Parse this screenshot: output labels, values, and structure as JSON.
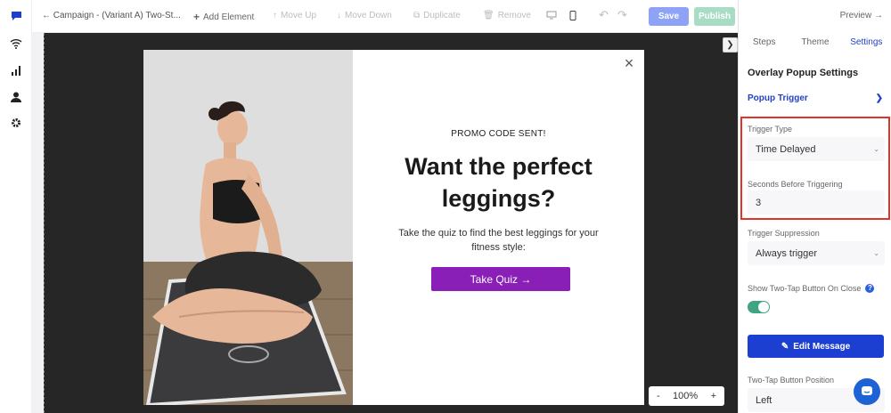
{
  "toolbar": {
    "back_label": "← Campaign - (Variant A) Two-St...",
    "add_element": "Add Element",
    "move_up": "Move Up",
    "move_down": "Move Down",
    "duplicate": "Duplicate",
    "remove": "Remove",
    "save": "Save",
    "publish": "Publish",
    "preview": "Preview →"
  },
  "popup": {
    "promo": "PROMO CODE SENT!",
    "headline_line1": "Want the perfect",
    "headline_line2": "leggings?",
    "sub_line1": "Take the quiz to find the best leggings for your",
    "sub_line2": "fitness style:",
    "cta": "Take Quiz →"
  },
  "zoom": {
    "minus": "-",
    "value": "100%",
    "plus": "+"
  },
  "panel": {
    "tabs": [
      "Steps",
      "Theme",
      "Settings"
    ],
    "active_tab": "Settings",
    "title": "Overlay Popup Settings",
    "accordion": "Popup Trigger",
    "trigger_type_label": "Trigger Type",
    "trigger_type_value": "Time Delayed",
    "seconds_label": "Seconds Before Triggering",
    "seconds_value": "3",
    "suppression_label": "Trigger Suppression",
    "suppression_value": "Always trigger",
    "two_tap_label": "Show Two-Tap Button On Close",
    "two_tap_on": true,
    "edit_message": "Edit Message",
    "position_label": "Two-Tap Button Position",
    "position_value": "Left"
  },
  "colors": {
    "accent_blue": "#1d3fd1",
    "cta_purple": "#8a1fb8",
    "highlight_red": "#e2322a",
    "toggle_green": "#3fa47f"
  },
  "icons": {
    "rail": [
      "chat-bubble-icon",
      "wifi-icon",
      "bar-chart-icon",
      "user-icon",
      "gear-icon"
    ]
  }
}
